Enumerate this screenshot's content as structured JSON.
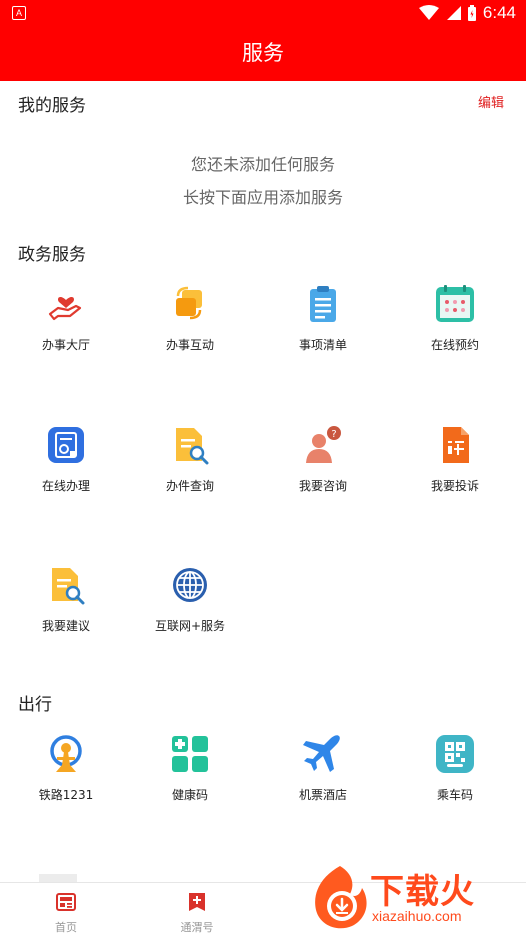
{
  "status_bar": {
    "time": "6:44"
  },
  "header": {
    "title": "服务"
  },
  "my_services": {
    "title": "我的服务",
    "edit_label": "编辑",
    "empty_line1": "您还未添加任何服务",
    "empty_line2": "长按下面应用添加服务"
  },
  "gov_services": {
    "title": "政务服务",
    "items": [
      {
        "label": "办事大厅",
        "icon": "hand-heart-icon"
      },
      {
        "label": "办事互动",
        "icon": "interaction-icon"
      },
      {
        "label": "事项清单",
        "icon": "clipboard-list-icon"
      },
      {
        "label": "在线预约",
        "icon": "calendar-icon"
      },
      {
        "label": "在线办理",
        "icon": "document-stamp-icon"
      },
      {
        "label": "办件查询",
        "icon": "document-search-icon"
      },
      {
        "label": "我要咨询",
        "icon": "consult-person-icon"
      },
      {
        "label": "我要投诉",
        "icon": "complaint-icon"
      },
      {
        "label": "我要建议",
        "icon": "suggestion-search-icon"
      },
      {
        "label": "互联网+服务",
        "icon": "globe-icon"
      }
    ]
  },
  "travel": {
    "title": "出行",
    "items": [
      {
        "label": "铁路1231",
        "icon": "railway-icon"
      },
      {
        "label": "健康码",
        "icon": "health-code-icon"
      },
      {
        "label": "机票酒店",
        "icon": "airplane-icon"
      },
      {
        "label": "乘车码",
        "icon": "ride-code-icon"
      }
    ]
  },
  "tab_bar": {
    "tabs": [
      {
        "label": "首页",
        "icon": "home-news-icon"
      },
      {
        "label": "通渭号",
        "icon": "plus-account-icon"
      }
    ]
  },
  "watermark": {
    "main": "下载火",
    "sub": "xiazaihuo.com"
  },
  "colors": {
    "brand_red": "#ff0000",
    "edit_red": "#e02020",
    "tab_active": "#d9322b"
  }
}
